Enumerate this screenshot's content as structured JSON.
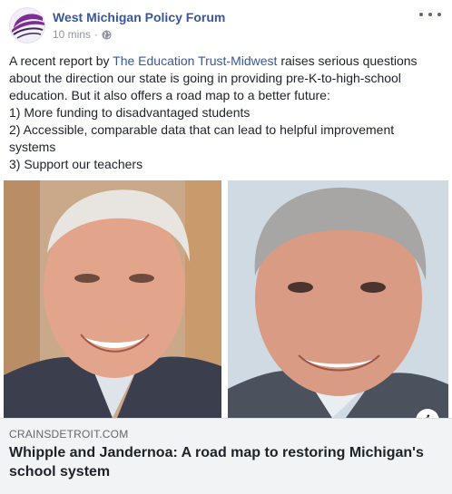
{
  "post": {
    "page_name": "West Michigan Policy Forum",
    "timestamp": "10 mins",
    "separator": "·",
    "privacy_icon": "globe-icon",
    "more_icon": "more-options-icon",
    "text": {
      "line1_prefix": "A recent report by ",
      "line1_link": "The Education Trust-Midwest",
      "line1_suffix": " raises serious questions",
      "line2": "about the direction our state is going in providing pre-K-to-high-school",
      "line3": "education. But it also offers a road map to a better future:",
      "line4": "1) More funding to disadvantaged students",
      "line5": "2) Accessible, comparable data that can lead to helpful improvement",
      "line6": "systems",
      "line7": "3) Support our teachers"
    }
  },
  "link_preview": {
    "info_icon": "info-icon",
    "info_glyph": "i",
    "domain": "CRAINSDETROIT.COM",
    "headline_line1": "Whipple and Jandernoa: A road map to restoring Michigan's",
    "headline_line2": "school system"
  },
  "colors": {
    "link_blue": "#385898",
    "text": "#1d2129",
    "meta_gray": "#90949c",
    "preview_bg": "#f2f3f5",
    "brand_purple": "#7b2f8e"
  }
}
